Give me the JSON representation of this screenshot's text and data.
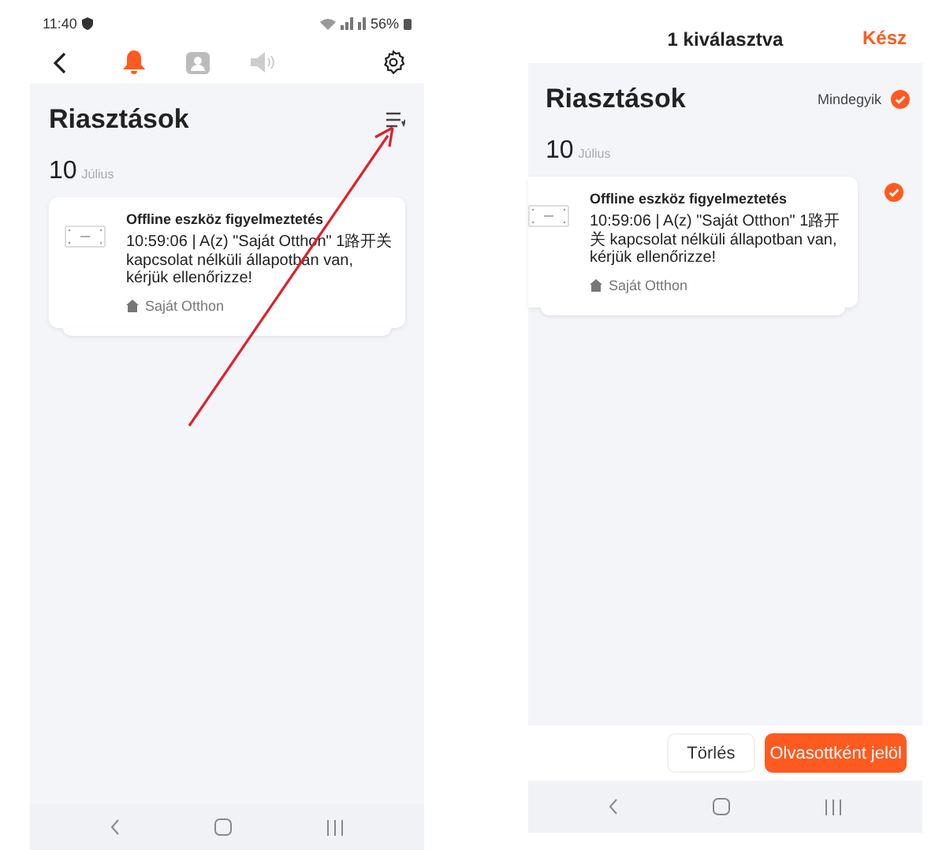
{
  "phones": [
    {
      "kind": "list",
      "status_bar": {
        "time": "11:40",
        "battery": "56%"
      },
      "tabs": [
        {
          "kind": "bell",
          "selected": true
        },
        {
          "kind": "person",
          "selected": false
        },
        {
          "kind": "speaker",
          "selected": false
        }
      ],
      "title": "Riasztások",
      "date": {
        "day": "10",
        "month": "Július"
      },
      "alerts": [
        {
          "title": "Offline eszköz figyelmeztetés",
          "message": "10:59:06 | A(z) \"Saját Otthon\" 1路开关 kapcsolat nélküli állapotban van, kérjük ellenőrizze!",
          "location": "Saját Otthon"
        }
      ]
    },
    {
      "kind": "select",
      "header": {
        "title": "1 kiválasztva",
        "done": "Kész"
      },
      "title": "Riasztások",
      "select_all": {
        "label": "Mindegyik",
        "checked": true
      },
      "date": {
        "day": "10",
        "month": "Július"
      },
      "alerts": [
        {
          "title": "Offline eszköz figyelmeztetés",
          "message": "10:59:06 | A(z) \"Saját Otthon\" 1路开关 kapcsolat nélküli állapotban van, kérjük ellenőrizze!",
          "location": "Saját Otthon",
          "checked": true
        }
      ],
      "actions": [
        "Törlés",
        "Olvasottként jelöl"
      ]
    }
  ]
}
